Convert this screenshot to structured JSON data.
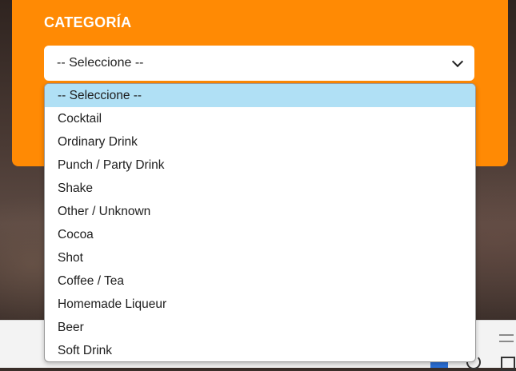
{
  "form": {
    "label": "CATEGORÍA",
    "select_value": "-- Seleccione --",
    "accent_color": "#ff8a04"
  },
  "dropdown": {
    "selected_index": 0,
    "highlight_color": "#b0e0f5",
    "options": [
      "-- Seleccione --",
      "Cocktail",
      "Ordinary Drink",
      "Punch / Party Drink",
      "Shake",
      "Other / Unknown",
      "Cocoa",
      "Shot",
      "Coffee / Tea",
      "Homemade Liqueur",
      "Beer",
      "Soft Drink"
    ]
  },
  "icons": {
    "select_arrow": "chevron-down-icon"
  }
}
